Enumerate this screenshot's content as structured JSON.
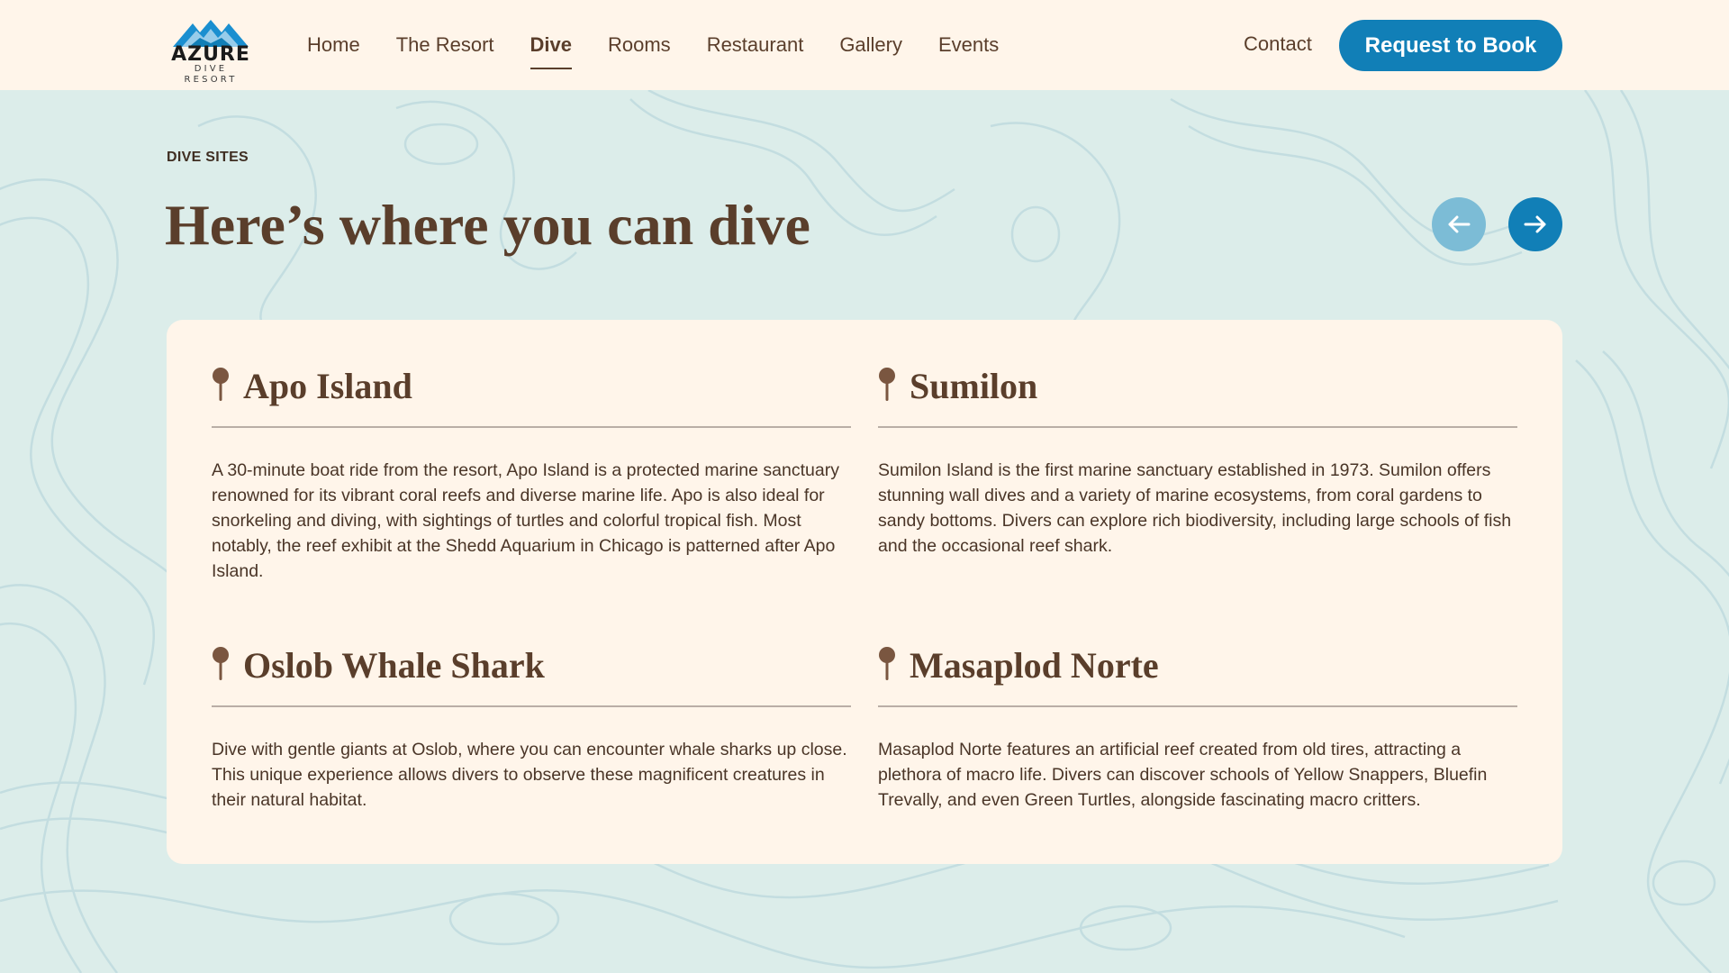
{
  "brand": {
    "name": "AZURE",
    "tagline": "DIVE RESORT",
    "primary_color": "#117fb7",
    "text_color": "#5a3e2b",
    "header_bg": "#fff5ea",
    "page_bg": "#dcedea"
  },
  "nav": {
    "items": [
      {
        "label": "Home",
        "active": false
      },
      {
        "label": "The Resort",
        "active": false
      },
      {
        "label": "Dive",
        "active": true
      },
      {
        "label": "Rooms",
        "active": false
      },
      {
        "label": "Restaurant",
        "active": false
      },
      {
        "label": "Gallery",
        "active": false
      },
      {
        "label": "Events",
        "active": false
      }
    ],
    "contact_label": "Contact",
    "book_label": "Request to Book"
  },
  "section": {
    "eyebrow": "DIVE SITES",
    "title": "Here’s where you can dive",
    "prev_icon": "arrow-left-icon",
    "next_icon": "arrow-right-icon"
  },
  "sites": [
    {
      "name": "Apo Island",
      "description": "A 30-minute boat ride from the resort, Apo Island is a protected marine sanctuary renowned for its vibrant coral reefs and diverse marine life. Apo is also ideal for snorkeling and diving, with sightings of turtles and colorful tropical fish. Most notably, the reef exhibit at the Shedd Aquarium in Chicago is patterned after Apo Island."
    },
    {
      "name": "Sumilon",
      "description": "Sumilon Island is the first marine sanctuary established in 1973. Sumilon offers stunning wall dives and a variety of marine ecosystems, from coral gardens to sandy bottoms. Divers can explore rich biodiversity, including large schools of fish and the occasional reef shark."
    },
    {
      "name": "Oslob Whale Shark",
      "description": "Dive with gentle giants at Oslob, where you can encounter whale sharks up close. This unique experience allows divers to observe these magnificent creatures in their natural habitat."
    },
    {
      "name": "Masaplod Norte",
      "description": "Masaplod Norte features an artificial reef created from old tires, attracting a plethora of macro life. Divers can discover schools of Yellow Snappers, Bluefin Trevally, and even Green Turtles, alongside fascinating macro critters."
    }
  ]
}
